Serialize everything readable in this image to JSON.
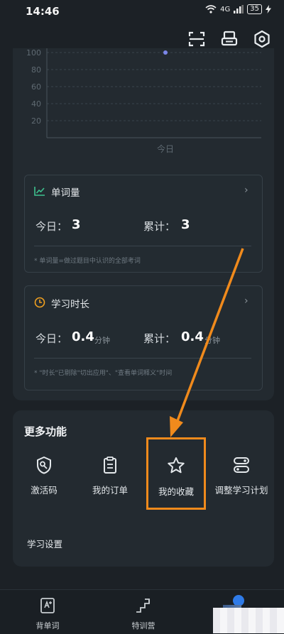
{
  "status_bar": {
    "time": "14:46",
    "network": "4G",
    "battery": "35"
  },
  "chart": {
    "y_ticks": [
      "100",
      "80",
      "60",
      "40",
      "20"
    ],
    "x_label": "今日"
  },
  "chart_data": {
    "type": "scatter",
    "title": "",
    "xlabel": "",
    "ylabel": "",
    "categories": [
      "今日"
    ],
    "values": [
      100
    ],
    "ylim": [
      0,
      100
    ],
    "grid": true
  },
  "words_card": {
    "title": "单词量",
    "today_label": "今日：",
    "today_value": "3",
    "total_label": "累计：",
    "total_value": "3",
    "note": "* 单词量=做过题目中认识的全部考词"
  },
  "time_card": {
    "title": "学习时长",
    "today_label": "今日：",
    "today_value": "0.4",
    "today_unit": "分钟",
    "total_label": "累计：",
    "total_value": "0.4",
    "total_unit": "分钟",
    "note": "* \"时长\"已剔除\"切出应用\"、\"查看单词释义\"时间"
  },
  "more": {
    "title": "更多功能",
    "items": [
      {
        "label": "激活码",
        "icon": "activation-code-icon"
      },
      {
        "label": "我的订单",
        "icon": "order-icon"
      },
      {
        "label": "我的收藏",
        "icon": "star-icon"
      },
      {
        "label": "调整学习计划",
        "icon": "plan-icon"
      }
    ],
    "settings": "学习设置"
  },
  "bottom_nav": {
    "items": [
      {
        "label": "背单词",
        "icon": "word-card-icon"
      },
      {
        "label": "特训营",
        "icon": "stairs-icon"
      },
      {
        "label": "",
        "icon": "profile-icon"
      }
    ]
  },
  "colors": {
    "highlight": "#f08a1c",
    "accent_blue": "#2f7be8",
    "accent_green": "#3ec28f"
  }
}
